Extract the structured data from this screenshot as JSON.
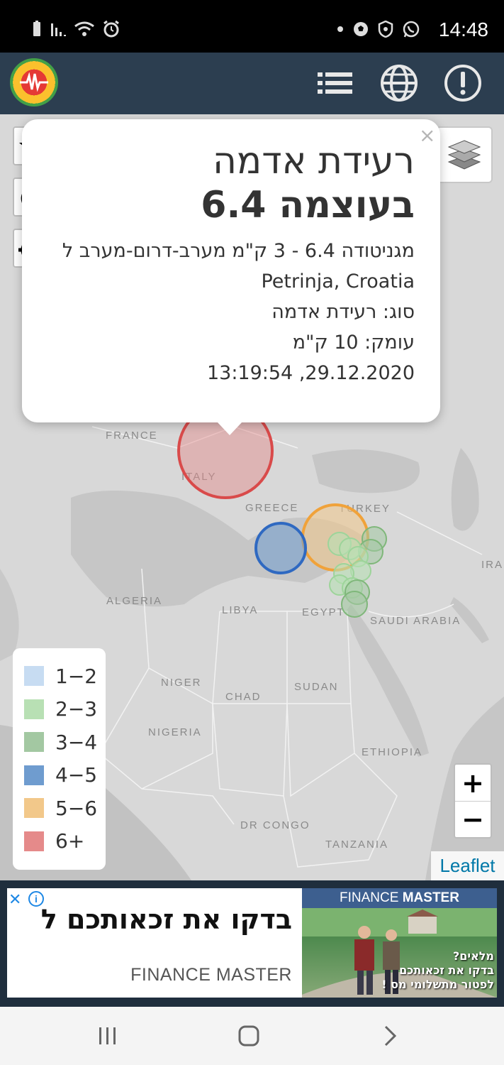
{
  "status_bar": {
    "time": "14:48",
    "left_icons": [
      "battery-icon",
      "signal-icon",
      "wifi-icon",
      "alarm-icon"
    ],
    "right_icons": [
      "dot-icon",
      "soccer-ball-icon",
      "shield-icon",
      "whatsapp-icon"
    ]
  },
  "app_bar": {
    "logo": "seismograph-logo-icon",
    "actions": [
      "list-icon",
      "globe-icon",
      "info-alert-icon"
    ]
  },
  "popup": {
    "title_line1": "רעידת אדמה",
    "title_line2": "בעוצמה 6.4",
    "description": "מגניטודה 6.4 - 3 ק\"מ מערב-דרום-מערב ל",
    "location": "Petrinja, Croatia",
    "type": "סוג: רעידת אדמה",
    "depth": "עומק: 10 ק\"מ",
    "datetime": "29.12.2020, 13:19:54",
    "close": "×"
  },
  "map": {
    "countries": [
      "FRANCE",
      "ITALY",
      "GREECE",
      "TURKEY",
      "ALGERIA",
      "LIBYA",
      "EGYPT",
      "SAUDI ARABIA",
      "IRA",
      "NIGER",
      "CHAD",
      "SUDAN",
      "NIGERIA",
      "ETHIOPIA",
      "DR CONGO",
      "TANZANIA"
    ],
    "controls": [
      "star-icon",
      "refresh-icon",
      "locate-icon"
    ],
    "zoom_in": "+",
    "zoom_out": "−",
    "attribution": "Leaflet"
  },
  "legend": {
    "items": [
      {
        "label": "1−2",
        "color": "#c7dcf2"
      },
      {
        "label": "2−3",
        "color": "#b8e0b4"
      },
      {
        "label": "3−4",
        "color": "#a3c8a2"
      },
      {
        "label": "4−5",
        "color": "#6f9ccf"
      },
      {
        "label": "5−6",
        "color": "#f2c88a"
      },
      {
        "label": "6+",
        "color": "#e58a8a"
      }
    ]
  },
  "quake_colors": {
    "six_plus": "#d94a4a",
    "five_six": "#f0a23a",
    "four_five": "#2f69c1",
    "three_four": "#7fb77a",
    "two_three": "#9dd49a"
  },
  "ad": {
    "headline": "בדקו את זכאותכם ל",
    "brand": "FINANCE MASTER",
    "right_header_plain": "FINANCE ",
    "right_header_bold": "MASTER",
    "right_text_1": "מלאים?",
    "right_text_2": "בדקו את זכאותכם",
    "right_text_3": "לפטור מתשלומי מס !"
  },
  "nav_bar": {
    "buttons": [
      "recent-apps-icon",
      "home-icon",
      "back-icon"
    ]
  }
}
